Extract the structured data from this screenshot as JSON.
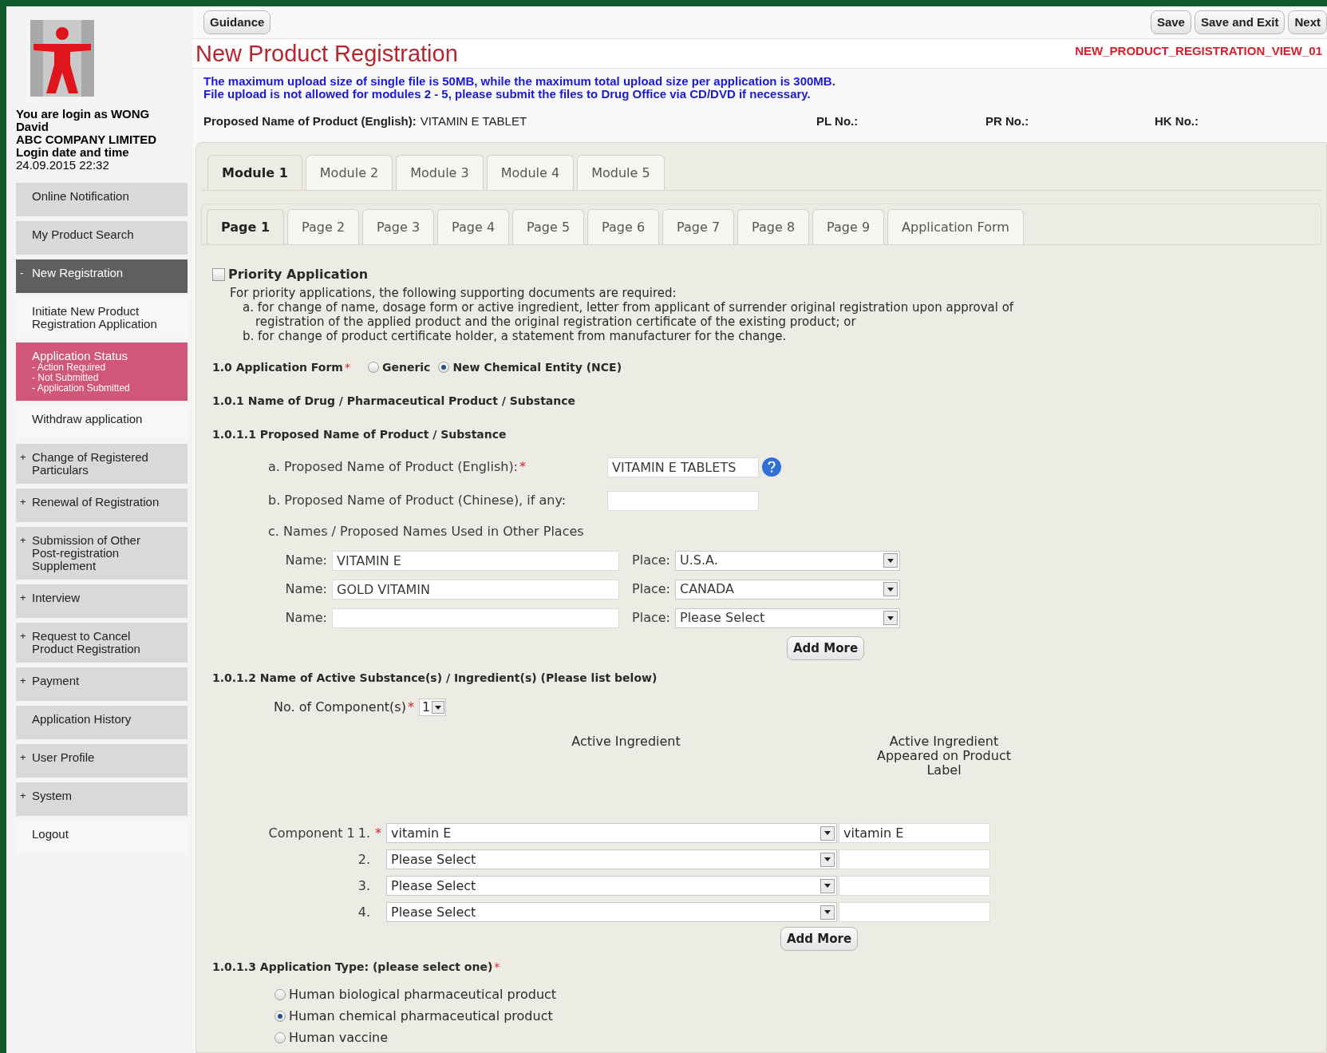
{
  "sidebar": {
    "user_info": [
      "You are login as WONG David",
      "ABC COMPANY LIMITED",
      "Login date and time"
    ],
    "login_time": "24.09.2015 22:32",
    "items": [
      {
        "kind": "menu",
        "label": "Online Notification",
        "selected": false
      },
      {
        "kind": "menu",
        "label": "My Product Search",
        "selected": false
      },
      {
        "kind": "section",
        "prefix": "-",
        "label": "New Registration",
        "selected": false
      },
      {
        "kind": "sub",
        "label": "Initiate New Product Registration Application",
        "selected": false
      },
      {
        "kind": "sub",
        "label": "Application Status",
        "details": [
          "- Action Required",
          "- Not Submitted",
          "- Application Submitted"
        ],
        "selected": true
      },
      {
        "kind": "sub",
        "label": "Withdraw application",
        "selected": false
      },
      {
        "kind": "menu",
        "prefix": "+",
        "label": "Change of Registered Particulars",
        "selected": false
      },
      {
        "kind": "menu",
        "prefix": "+",
        "label": "Renewal of Registration",
        "selected": false
      },
      {
        "kind": "menu",
        "prefix": "+",
        "label": "Submission of Other Post-registration Supplement",
        "selected": false
      },
      {
        "kind": "menu",
        "prefix": "+",
        "label": "Interview",
        "selected": false
      },
      {
        "kind": "menu",
        "prefix": "+",
        "label": "Request to Cancel Product Registration",
        "selected": false
      },
      {
        "kind": "menu",
        "prefix": "+",
        "label": "Payment",
        "selected": false
      },
      {
        "kind": "menu",
        "label": "Application History",
        "selected": false
      },
      {
        "kind": "menu",
        "prefix": "+",
        "label": "User Profile",
        "selected": false
      },
      {
        "kind": "menu",
        "prefix": "+",
        "label": "System",
        "selected": false
      },
      {
        "kind": "sub",
        "label": "Logout",
        "selected": false
      }
    ]
  },
  "toolbar": {
    "left": [
      "Guidance"
    ],
    "right": [
      "Save",
      "Save and Exit",
      "Next"
    ]
  },
  "title": "New Product Registration",
  "view_id": "NEW_PRODUCT_REGISTRATION_VIEW_01",
  "notices": [
    "The maximum upload size of single file is 50MB, while the maximum total upload size per application is 300MB.",
    "File upload is not allowed for modules 2 - 5, please submit the files to Drug Office via CD/DVD if necessary."
  ],
  "summary": [
    {
      "label": "Proposed Name of Product (English):",
      "value": "VITAMIN E TABLET"
    },
    {
      "label": "PL No.:"
    },
    {
      "label": "PR No.:"
    },
    {
      "label": "HK No.:"
    }
  ],
  "module_tabs": [
    {
      "label": "Module 1",
      "selected": true
    },
    {
      "label": "Module 2",
      "selected": false
    },
    {
      "label": "Module 3",
      "selected": false
    },
    {
      "label": "Module 4",
      "selected": false
    },
    {
      "label": "Module 5",
      "selected": false
    }
  ],
  "page_tabs": [
    {
      "label": "Page 1",
      "selected": true
    },
    {
      "label": "Page 2",
      "selected": false
    },
    {
      "label": "Page 3",
      "selected": false
    },
    {
      "label": "Page 4",
      "selected": false
    },
    {
      "label": "Page 5",
      "selected": false
    },
    {
      "label": "Page 6",
      "selected": false
    },
    {
      "label": "Page 7",
      "selected": false
    },
    {
      "label": "Page 8",
      "selected": false
    },
    {
      "label": "Page 9",
      "selected": false
    },
    {
      "label": "Application Form",
      "selected": false
    }
  ],
  "priority": {
    "label": "Priority Application",
    "checked": false,
    "intro": "For priority applications, the following supporting documents are required:",
    "items": [
      "a. for change of name, dosage form or active ingredient, letter from applicant of surrender original registration upon approval of registration of the applied product and the original registration certificate of the existing product; or",
      "b. for change of product certificate holder, a statement from manufacturer for the change."
    ]
  },
  "application_form": {
    "label": "1.0 Application Form",
    "required_mark": "*",
    "options": [
      {
        "label": "Generic",
        "selected": false
      },
      {
        "label": "New Chemical Entity (NCE)",
        "selected": true
      }
    ]
  },
  "heading_1_0_1": "1.0.1 Name of Drug / Pharmaceutical Product / Substance",
  "heading_1_0_1_1": "1.0.1.1 Proposed Name of Product / Substance",
  "name_fields": [
    {
      "label": "a. Proposed Name of Product (English):",
      "required_mark": "*",
      "value": "VITAMIN E TABLETS",
      "help": true
    },
    {
      "label": "b. Proposed Name of Product (Chinese), if any:",
      "help": false
    }
  ],
  "other_names": {
    "label": "c. Names / Proposed Names Used in Other Places",
    "rows": [
      {
        "name_label": "Name:",
        "name": "VITAMIN E",
        "place_label": "Place:",
        "place": "U.S.A."
      },
      {
        "name_label": "Name:",
        "name": "GOLD VITAMIN",
        "place_label": "Place:",
        "place": "CANADA"
      },
      {
        "name_label": "Name:",
        "place_label": "Place:",
        "place": "Please Select"
      }
    ],
    "button": "Add More"
  },
  "active": {
    "heading": "1.0.1.2 Name of Active Substance(s) / Ingredient(s) (Please list below)",
    "count_label": "No. of Component(s)",
    "required_mark": "*",
    "count": "1",
    "columns": [
      "Active Ingredient",
      "Active Ingredient Appeared on Product Label"
    ],
    "rows": [
      {
        "prefix": "Component 1",
        "number": "1.",
        "required_mark": "*",
        "ingredient": "vitamin E",
        "label_value": "vitamin E"
      },
      {
        "number": "2.",
        "ingredient": "Please Select"
      },
      {
        "number": "3.",
        "ingredient": "Please Select"
      },
      {
        "number": "4.",
        "ingredient": "Please Select"
      }
    ],
    "button": "Add More"
  },
  "application_type": {
    "heading": "1.0.1.3 Application Type: (please select one)",
    "required_mark": "*",
    "options": [
      {
        "label": "Human biological pharmaceutical product",
        "selected": false
      },
      {
        "label": "Human chemical pharmaceutical product",
        "selected": true
      },
      {
        "label": "Human vaccine",
        "selected": false
      }
    ]
  }
}
